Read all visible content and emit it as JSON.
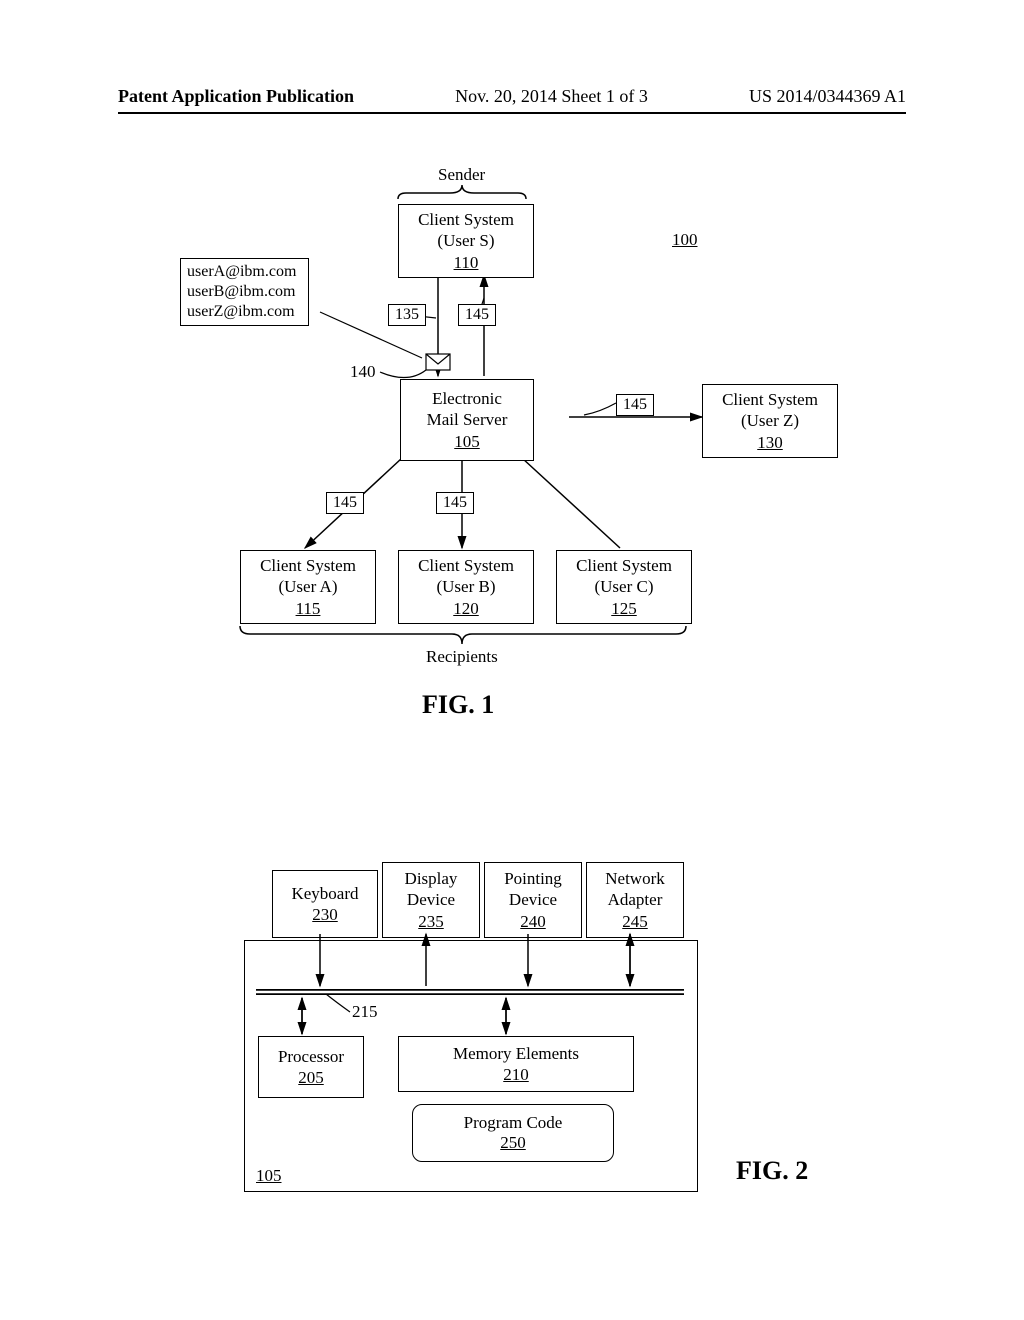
{
  "header": {
    "left": "Patent Application Publication",
    "center": "Nov. 20, 2014  Sheet 1 of 3",
    "right": "US 2014/0344369 A1"
  },
  "fig1": {
    "title": "FIG. 1",
    "system_ref": "100",
    "sender_label": "Sender",
    "recipients_label": "Recipients",
    "sender_box": {
      "l1": "Client System",
      "l2": "(User S)",
      "ref": "110"
    },
    "server_box": {
      "l1": "Electronic",
      "l2": "Mail Server",
      "ref": "105"
    },
    "userA_box": {
      "l1": "Client System",
      "l2": "(User A)",
      "ref": "115"
    },
    "userB_box": {
      "l1": "Client System",
      "l2": "(User B)",
      "ref": "120"
    },
    "userC_box": {
      "l1": "Client System",
      "l2": "(User C)",
      "ref": "125"
    },
    "userZ_box": {
      "l1": "Client System",
      "l2": "(User Z)",
      "ref": "130"
    },
    "emails": {
      "l1": "userA@ibm.com",
      "l2": "userB@ibm.com",
      "l3": "userZ@ibm.com"
    },
    "refs": {
      "msg_out": "135",
      "addr_list": "140",
      "msg_in_1": "145",
      "msg_in_2": "145",
      "msg_in_3": "145",
      "msg_in_4": "145"
    }
  },
  "fig2": {
    "title": "FIG. 2",
    "system_ref": "105",
    "bus_ref": "215",
    "keyboard": {
      "l1": "Keyboard",
      "ref": "230"
    },
    "display": {
      "l1": "Display",
      "l2": "Device",
      "ref": "235"
    },
    "pointing": {
      "l1": "Pointing",
      "l2": "Device",
      "ref": "240"
    },
    "network": {
      "l1": "Network",
      "l2": "Adapter",
      "ref": "245"
    },
    "processor": {
      "l1": "Processor",
      "ref": "205"
    },
    "memory": {
      "l1": "Memory Elements",
      "ref": "210"
    },
    "program": {
      "l1": "Program Code",
      "ref": "250"
    }
  }
}
